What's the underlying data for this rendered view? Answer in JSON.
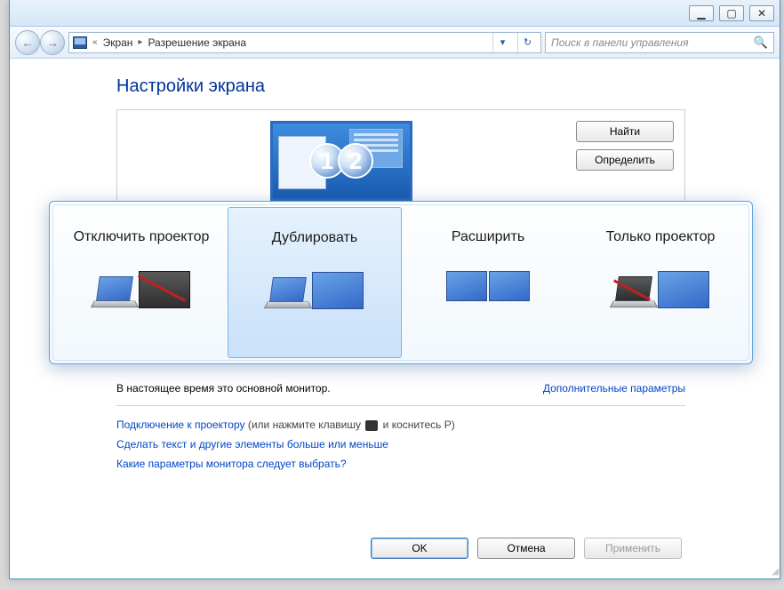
{
  "titlebar": {},
  "nav": {
    "crumb1": "Экран",
    "crumb2": "Разрешение экрана",
    "search_placeholder": "Поиск в панели управления"
  },
  "heading": "Настройки экрана",
  "panel": {
    "display_numbers": [
      "1",
      "2"
    ],
    "btn_find": "Найти",
    "btn_identify": "Определить"
  },
  "popup": {
    "options": [
      {
        "label": "Отключить проектор"
      },
      {
        "label": "Дублировать"
      },
      {
        "label": "Расширить"
      },
      {
        "label": "Только проектор"
      }
    ],
    "selected_index": 1
  },
  "status": {
    "primary_text": "В настоящее время это основной монитор.",
    "adv_link": "Дополнительные параметры"
  },
  "info": {
    "line1_link": "Подключение к проектору",
    "line1_rest_a": " (или нажмите клавишу ",
    "line1_rest_b": " и коснитесь P)",
    "line2": "Сделать текст и другие элементы больше или меньше",
    "line3": "Какие параметры монитора следует выбрать?"
  },
  "buttons": {
    "ok": "OK",
    "cancel": "Отмена",
    "apply": "Применить"
  }
}
